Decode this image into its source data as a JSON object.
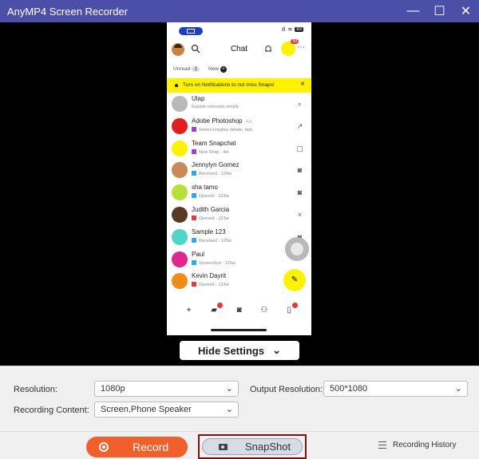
{
  "app": {
    "title": "AnyMP4 Screen Recorder"
  },
  "window_controls": {
    "minimize": "—",
    "maximize": "☐",
    "close": "✕"
  },
  "phone": {
    "status": {
      "signal": "ıll",
      "wifi": "≋",
      "battery": "83"
    },
    "header": {
      "title": "Chat",
      "badge": "99"
    },
    "filters": {
      "unread": "Unread",
      "unread_count": "1",
      "new": "New"
    },
    "banner": {
      "text": "Turn on Notifications to not miss Snaps!"
    },
    "chats": [
      {
        "name": "Ulap",
        "sub": "Explain concepts simply",
        "color": "#b9b9b9",
        "icon": "⌕",
        "status_color": ""
      },
      {
        "name": "Adobe Photoshop",
        "ad": "Ad",
        "sub": "Select complex details, fast.",
        "color": "#e02020",
        "icon": "↗",
        "status_color": "#9b3fd6"
      },
      {
        "name": "Team Snapchat",
        "sub": "New Snap · 4w",
        "color": "#fff200",
        "icon": "▢",
        "status_color": "#9b3fd6"
      },
      {
        "name": "Jennylyn Gomez",
        "sub": "Received · 120w",
        "color": "#c98a5a",
        "icon": "◙",
        "status_color": "#33a8e6"
      },
      {
        "name": "sha tamo",
        "sub": "Opened · 123w",
        "color": "#b6e03a",
        "icon": "◙",
        "status_color": "#33a8e6"
      },
      {
        "name": "Judith Garcia",
        "sub": "Opened · 123w",
        "color": "#5a3a22",
        "icon": "×",
        "status_color": "#e53950"
      },
      {
        "name": "Sample 123",
        "sub": "Received · 125w",
        "color": "#4fd6c9",
        "icon": "◙",
        "status_color": "#33a8e6"
      },
      {
        "name": "Paul",
        "sub": "Screenshot · 125w",
        "color": "#e0288c",
        "icon": "",
        "status_color": "#33a8e6"
      },
      {
        "name": "Kevin Dayrit",
        "sub": "Opened · 123w",
        "color": "#f08c1c",
        "icon": "",
        "status_color": "#e53950"
      }
    ]
  },
  "hide_settings": {
    "label": "Hide Settings",
    "chevron": "⌄"
  },
  "settings": {
    "resolution_label": "Resolution:",
    "resolution_value": "1080p",
    "output_resolution_label": "Output Resolution:",
    "output_resolution_value": "500*1080",
    "recording_content_label": "Recording Content:",
    "recording_content_value": "Screen,Phone Speaker"
  },
  "footer": {
    "record_label": "Record",
    "snapshot_label": "SnapShot",
    "history_label": "Recording History"
  },
  "colors": {
    "titlebar": "#4b4fa8",
    "record": "#f0602d",
    "snapchat_yellow": "#fff200"
  }
}
